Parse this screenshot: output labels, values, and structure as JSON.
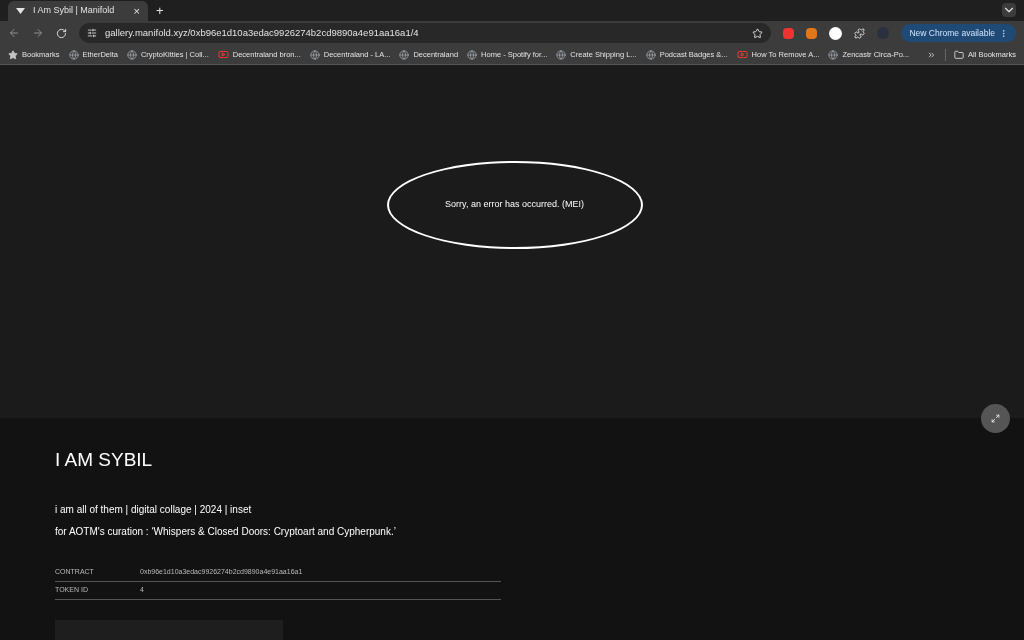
{
  "tab": {
    "title": "I Am Sybil | Manifold",
    "close": "×",
    "new_tab": "+"
  },
  "address": {
    "value": "gallery.manifold.xyz/0xb96e1d10a3edac9926274b2cd9890a4e91aa16a1/4"
  },
  "update_button": "New Chrome available",
  "bookmarks": [
    {
      "label": "Bookmarks",
      "kind": "star"
    },
    {
      "label": "EtherDelta",
      "kind": "site"
    },
    {
      "label": "CryptoKitties | Coll...",
      "kind": "site"
    },
    {
      "label": "Decentraland bron...",
      "kind": "video"
    },
    {
      "label": "Decentraland - LA...",
      "kind": "site"
    },
    {
      "label": "Decentraland",
      "kind": "site"
    },
    {
      "label": "Home - Spotify for...",
      "kind": "site"
    },
    {
      "label": "Create Shipping L...",
      "kind": "site"
    },
    {
      "label": "Podcast Badges &...",
      "kind": "site"
    },
    {
      "label": "How To Remove A...",
      "kind": "video"
    },
    {
      "label": "Zencastr Circa-Po...",
      "kind": "site"
    }
  ],
  "all_bookmarks": "All Bookmarks",
  "media": {
    "error": "Sorry, an error has occurred. (MEI)"
  },
  "artwork": {
    "title": "I AM SYBIL",
    "description": [
      "i am all of them | digital collage | 2024 | inset",
      "for AOTM's curation : ‘Whispers & Closed Doors: Cryptoart and Cypherpunk.’"
    ],
    "details": [
      {
        "label": "CONTRACT",
        "value": "0xb96e1d10a3edac9926274b2cd9890a4e91aa16a1"
      },
      {
        "label": "TOKEN ID",
        "value": "4"
      }
    ]
  }
}
